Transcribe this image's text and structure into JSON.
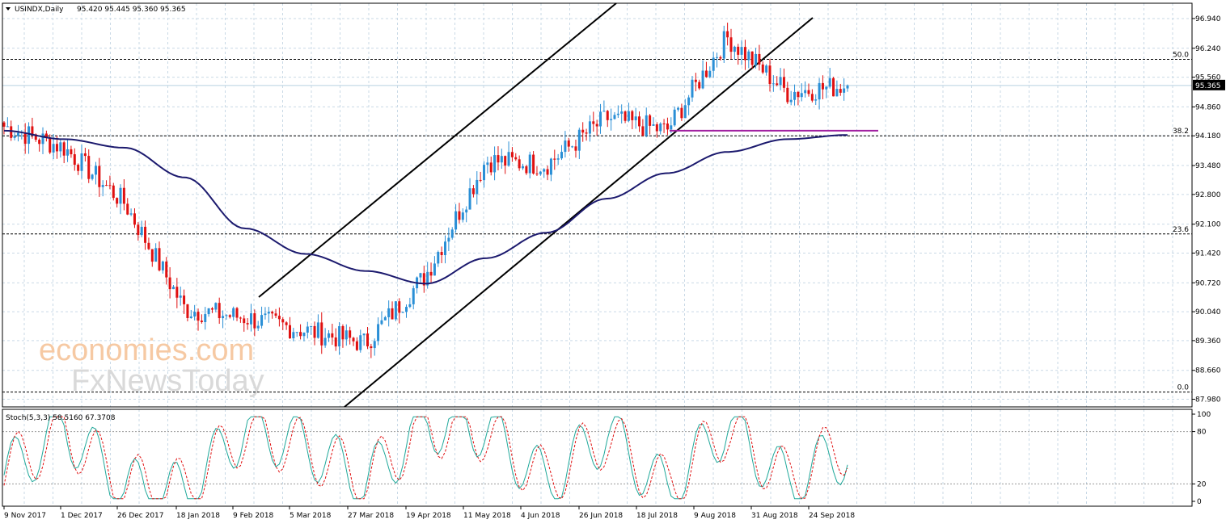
{
  "header": {
    "symbol_label": "USINDX,Daily",
    "ohlc": "95.420 95.445 95.360 95.365"
  },
  "stoch_header": "Stoch(5,3,3) 58.5160 67.3708",
  "current_price_tag": "95.365",
  "price_ticks": [
    "96.940",
    "96.240",
    "95.560",
    "94.860",
    "94.180",
    "93.480",
    "92.800",
    "92.100",
    "91.420",
    "90.720",
    "90.040",
    "89.360",
    "88.660",
    "87.980"
  ],
  "stoch_ticks": [
    "100",
    "80",
    "20",
    "0"
  ],
  "date_ticks": [
    "9 Nov 2017",
    "1 Dec 2017",
    "26 Dec 2017",
    "18 Jan 2018",
    "9 Feb 2018",
    "5 Mar 2018",
    "27 Mar 2018",
    "19 Apr 2018",
    "11 May 2018",
    "4 Jun 2018",
    "26 Jun 2018",
    "18 Jul 2018",
    "9 Aug 2018",
    "31 Aug 2018",
    "24 Sep 2018"
  ],
  "fib_levels": [
    {
      "label": "50.0",
      "price": 95.98
    },
    {
      "label": "38.2",
      "price": 94.18
    },
    {
      "label": "23.6",
      "price": 91.87
    },
    {
      "label": "0.0",
      "price": 88.15
    }
  ],
  "watermark": {
    "line1": "economies.com",
    "line2": "FxNewsToday"
  },
  "colors": {
    "bull": "#2a8fd6",
    "bear": "#e01010",
    "ma": "#1c1a6e",
    "horizontal_line": "#a020a0",
    "grid": "#c9d9e6",
    "stoch_k": "#1fa89a",
    "stoch_d": "#e01010"
  },
  "chart_data": {
    "type": "line",
    "title": "USINDX,Daily",
    "price_range": [
      87.8,
      97.3
    ],
    "stoch_range": [
      0,
      100
    ],
    "series": [
      {
        "name": "USINDX,Daily",
        "type": "candlestick",
        "x": [
          "9 Nov 2017",
          "1 Dec 2017",
          "26 Dec 2017",
          "18 Jan 2018",
          "9 Feb 2018",
          "5 Mar 2018",
          "27 Mar 2018",
          "19 Apr 2018",
          "11 May 2018",
          "4 Jun 2018",
          "26 Jun 2018",
          "18 Jul 2018",
          "9 Aug 2018",
          "31 Aug 2018",
          "24 Sep 2018"
        ],
        "values": [
          94.4,
          93.9,
          92.6,
          90.1,
          89.9,
          89.6,
          89.3,
          90.9,
          93.6,
          93.5,
          94.6,
          94.3,
          96.5,
          95.2,
          95.365
        ]
      },
      {
        "type": "moving-average",
        "values": [
          94.3,
          94.1,
          93.9,
          93.2,
          92.0,
          91.4,
          91.0,
          90.7,
          91.3,
          91.9,
          92.7,
          93.3,
          93.8,
          94.1,
          94.2
        ]
      },
      {
        "name": "Stoch(5,3,3)",
        "values": [
          30,
          85,
          15,
          10,
          85,
          65,
          20,
          90,
          85,
          20,
          80,
          10,
          90,
          20,
          58.516
        ]
      },
      {
        "type": "signal",
        "values": [
          35,
          80,
          20,
          15,
          80,
          60,
          25,
          85,
          80,
          25,
          75,
          15,
          85,
          25,
          67.3708
        ]
      }
    ],
    "horizontal_level": 94.3,
    "last_close": 95.365,
    "grid": true
  }
}
